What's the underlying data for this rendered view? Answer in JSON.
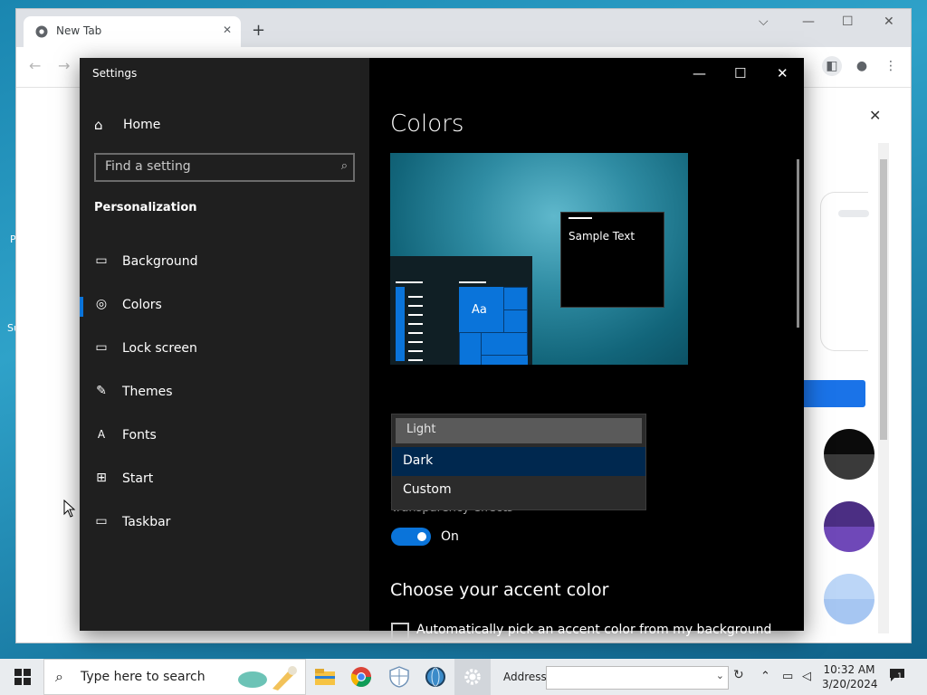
{
  "browser": {
    "tab_title": "New Tab",
    "new_tab_symbol": "+",
    "tab_close_symbol": "✕"
  },
  "settings": {
    "window_title": "Settings",
    "home_label": "Home",
    "search_placeholder": "Find a setting",
    "section_heading": "Personalization",
    "nav_items": [
      {
        "label": "Background",
        "icon": "image-icon"
      },
      {
        "label": "Colors",
        "icon": "palette-icon",
        "selected": true
      },
      {
        "label": "Lock screen",
        "icon": "lock-screen-icon"
      },
      {
        "label": "Themes",
        "icon": "themes-icon"
      },
      {
        "label": "Fonts",
        "icon": "fonts-icon"
      },
      {
        "label": "Start",
        "icon": "start-icon"
      },
      {
        "label": "Taskbar",
        "icon": "taskbar-icon"
      }
    ],
    "page_title": "Colors",
    "preview_sample_text": "Sample Text",
    "preview_tile_text": "Aa",
    "color_mode_options": [
      "Light",
      "Dark",
      "Custom"
    ],
    "color_mode_highlighted": "Dark",
    "transparency_label": "Transparency effects",
    "transparency_state": "On",
    "accent_heading": "Choose your accent color",
    "auto_accent_label": "Automatically pick an accent color from my background",
    "accent_color": "#0a74da"
  },
  "taskbar": {
    "search_placeholder": "Type here to search",
    "address_label": "Address",
    "address_value": "",
    "time": "10:32 AM",
    "date": "3/20/2024",
    "notification_count": "1"
  }
}
